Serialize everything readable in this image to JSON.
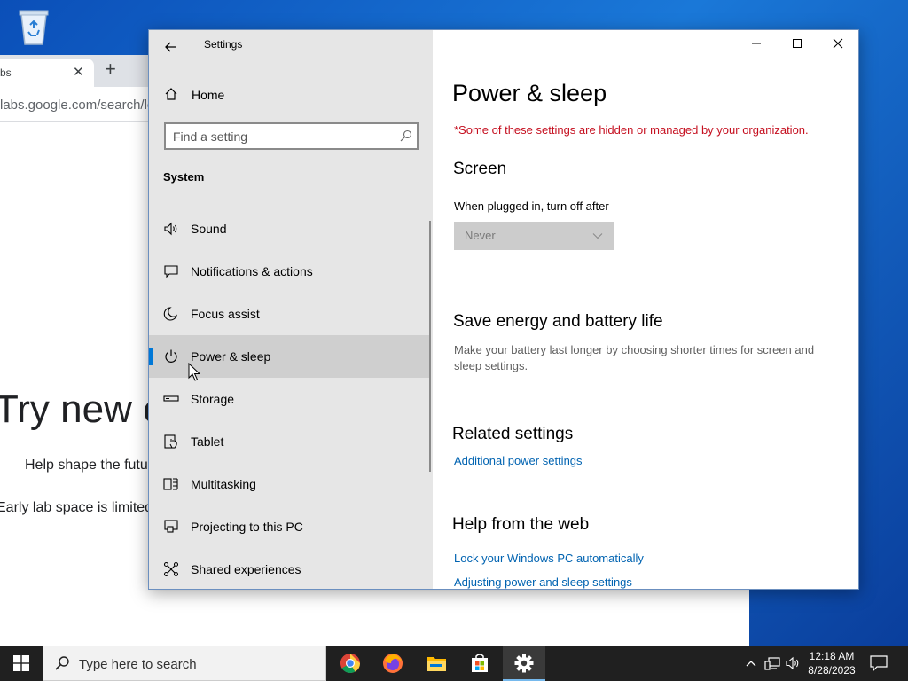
{
  "browser": {
    "tab_label": "bs",
    "tab_close_glyph": "✕",
    "new_tab_glyph": "+",
    "url": "labs.google.com/search/log",
    "headline": "Try new e",
    "line1": "Help shape the futu",
    "line2": "Early lab space is limited"
  },
  "settings": {
    "title": "Settings",
    "home_label": "Home",
    "search_placeholder": "Find a setting",
    "section": "System",
    "nav_items": [
      {
        "label": "Sound",
        "icon": "speaker-icon"
      },
      {
        "label": "Notifications & actions",
        "icon": "notification-icon"
      },
      {
        "label": "Focus assist",
        "icon": "moon-icon"
      },
      {
        "label": "Power & sleep",
        "icon": "power-icon",
        "active": true
      },
      {
        "label": "Storage",
        "icon": "storage-icon"
      },
      {
        "label": "Tablet",
        "icon": "tablet-icon"
      },
      {
        "label": "Multitasking",
        "icon": "multitasking-icon"
      },
      {
        "label": "Projecting to this PC",
        "icon": "projecting-icon"
      },
      {
        "label": "Shared experiences",
        "icon": "shared-icon"
      }
    ],
    "content": {
      "page_title": "Power & sleep",
      "org_warning": "*Some of these settings are hidden or managed by your organization.",
      "screen_heading": "Screen",
      "plugged_in_label": "When plugged in, turn off after",
      "plugged_in_value": "Never",
      "save_energy_heading": "Save energy and battery life",
      "save_energy_desc": "Make your battery last longer by choosing shorter times for screen and sleep settings.",
      "related_heading": "Related settings",
      "related_link": "Additional power settings",
      "help_heading": "Help from the web",
      "help_links": [
        "Lock your Windows PC automatically",
        "Adjusting power and sleep settings"
      ]
    }
  },
  "taskbar": {
    "search_placeholder": "Type here to search",
    "apps": [
      "chrome-icon",
      "firefox-icon",
      "file-explorer-icon",
      "store-icon",
      "settings-icon"
    ],
    "time": "12:18 AM",
    "date": "8/28/2023"
  },
  "colors": {
    "accent": "#0078d7",
    "warning": "#c50f1f",
    "link": "#0063b1"
  }
}
